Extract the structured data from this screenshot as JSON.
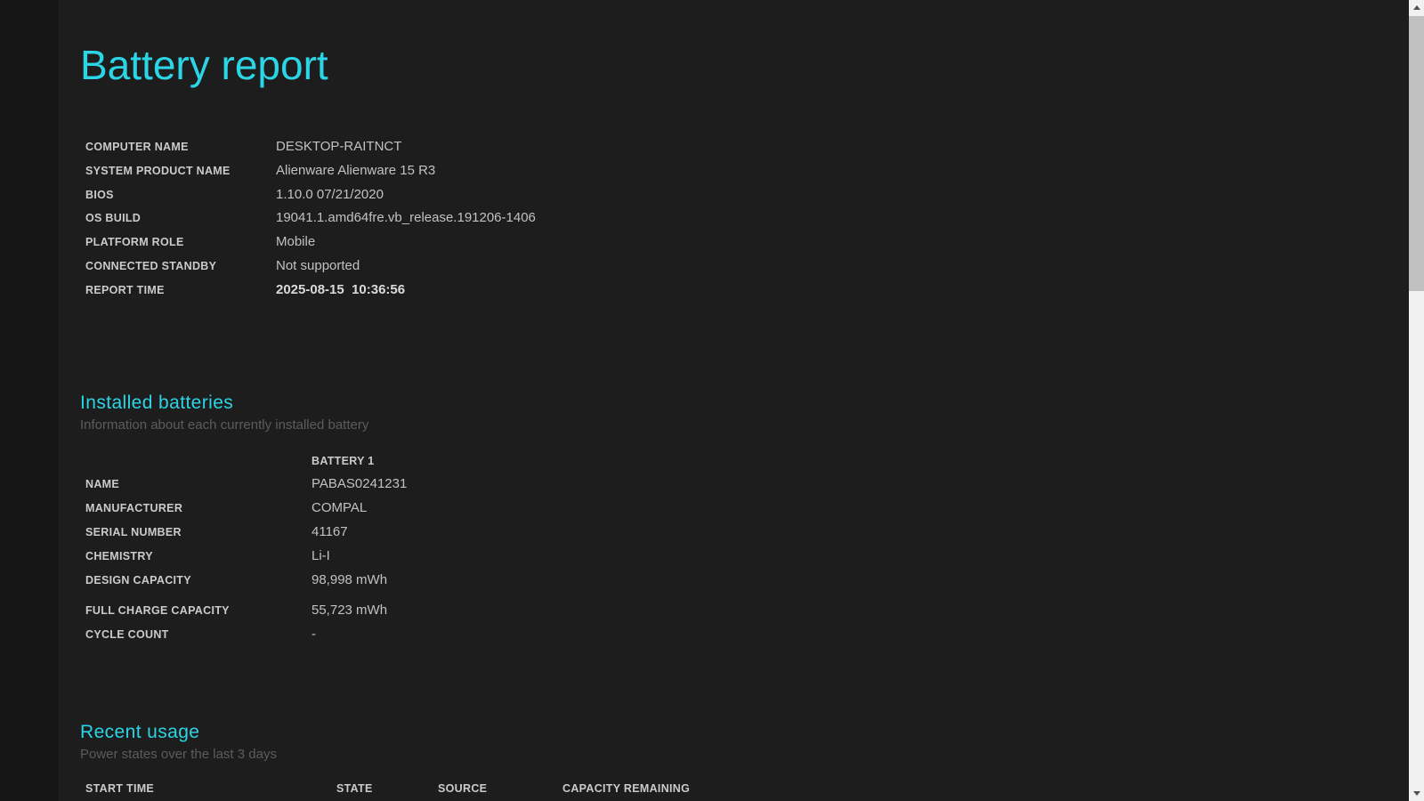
{
  "colors": {
    "accent_cyan": "#2bd5e6",
    "page_background": "#1d1d1d",
    "left_strip_background": "#161616",
    "label_text": "#cbcbcb",
    "value_text": "#c2c2c2",
    "subtitle_text": "#5c5c5c",
    "scrollbar_track": "#f1f1f1",
    "scrollbar_thumb": "#c1c1c1"
  },
  "header": {
    "title": "Battery report"
  },
  "system": {
    "rows": [
      {
        "label": "COMPUTER NAME",
        "value": "DESKTOP-RAITNCT"
      },
      {
        "label": "SYSTEM PRODUCT NAME",
        "value": "Alienware Alienware 15 R3"
      },
      {
        "label": "BIOS",
        "value": "1.10.0 07/21/2020"
      },
      {
        "label": "OS BUILD",
        "value": "19041.1.amd64fre.vb_release.191206-1406"
      },
      {
        "label": "PLATFORM ROLE",
        "value": "Mobile"
      },
      {
        "label": "CONNECTED STANDBY",
        "value": "Not supported"
      },
      {
        "label": "REPORT TIME",
        "value": "2025-08-15  10:36:56"
      }
    ]
  },
  "batteries": {
    "heading": "Installed batteries",
    "subtitle": "Information about each currently installed battery",
    "column_header": "BATTERY 1",
    "rows": [
      {
        "label": "NAME",
        "value": "PABAS0241231"
      },
      {
        "label": "MANUFACTURER",
        "value": "COMPAL"
      },
      {
        "label": "SERIAL NUMBER",
        "value": "41167"
      },
      {
        "label": "CHEMISTRY",
        "value": "Li-I"
      },
      {
        "label": "DESIGN CAPACITY",
        "value": "98,998 mWh"
      },
      {
        "label": "FULL CHARGE CAPACITY",
        "value": "55,723 mWh"
      },
      {
        "label": "CYCLE COUNT",
        "value": "-"
      }
    ]
  },
  "recent_usage": {
    "heading": "Recent usage",
    "subtitle": "Power states over the last 3 days",
    "columns": [
      "START TIME",
      "STATE",
      "SOURCE",
      "CAPACITY REMAINING"
    ]
  }
}
